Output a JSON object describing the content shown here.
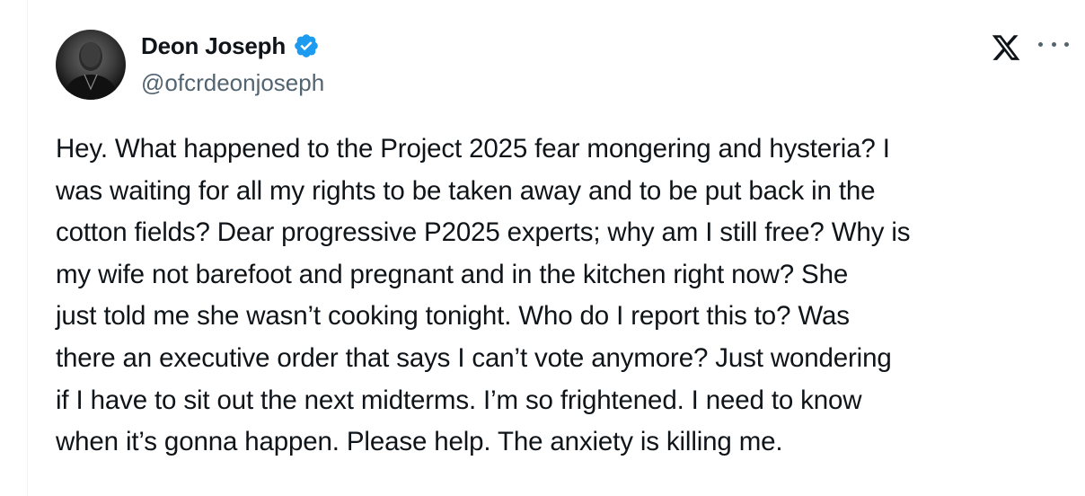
{
  "author": {
    "display_name": "Deon Joseph",
    "handle": "@ofcrdeonjoseph",
    "verified": true,
    "verified_color": "#1d9bf0"
  },
  "icons": {
    "avatar": "profile-photo",
    "verified": "verified-badge-icon",
    "logo": "x-logo-icon",
    "more": "more-options-icon"
  },
  "tweet": {
    "text": "Hey. What happened to the Project 2025 fear mongering and hysteria? I\nwas waiting for all my rights to be taken away and to be put back in the\ncotton fields? Dear progressive P2025 experts; why am I still free? Why is\nmy wife not barefoot and pregnant and in the kitchen right now?  She\njust told me she wasn’t cooking tonight. Who do I report this to?  Was\nthere an executive order that says I can’t vote anymore? Just wondering\nif I have to sit out the next midterms. I’m so frightened. I need  to know\nwhen it’s gonna happen.  Please help.  The anxiety is killing me."
  },
  "colors": {
    "text": "#0f1419",
    "secondary_text": "#536471",
    "background": "#ffffff"
  }
}
